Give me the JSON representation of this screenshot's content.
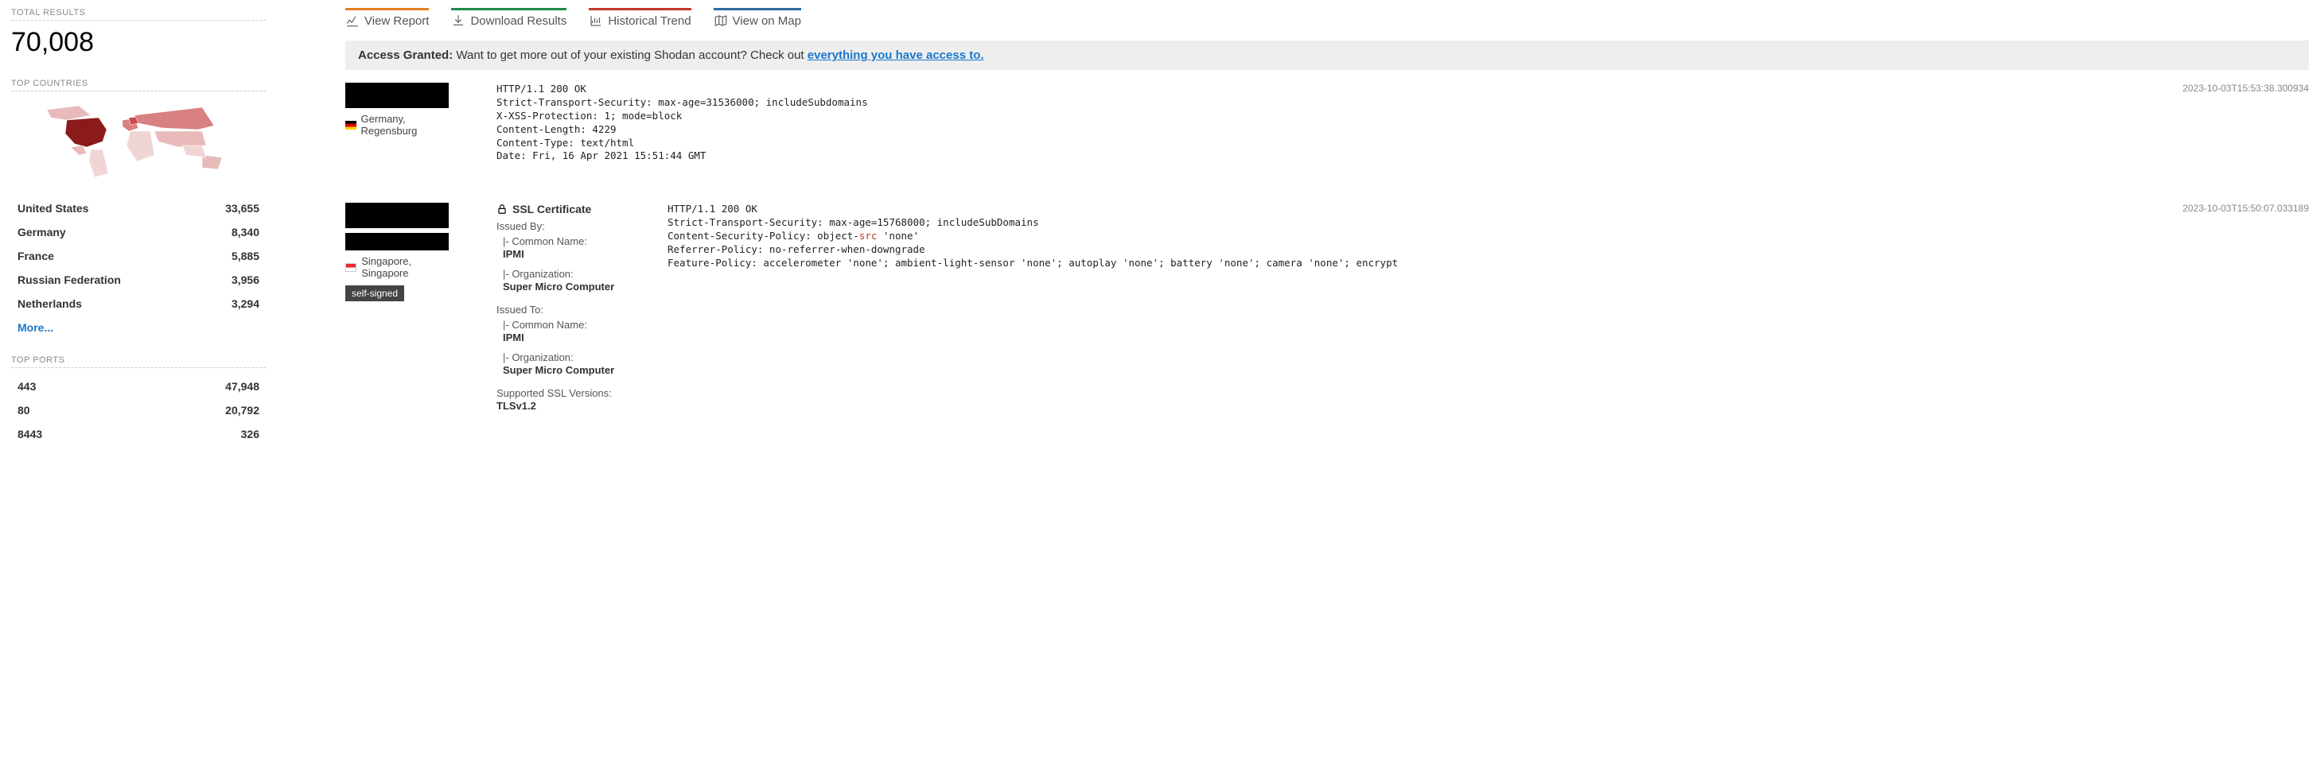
{
  "sidebar": {
    "total_results_label": "TOTAL RESULTS",
    "total_results_value": "70,008",
    "top_countries_label": "TOP COUNTRIES",
    "countries": [
      {
        "name": "United States",
        "count": "33,655"
      },
      {
        "name": "Germany",
        "count": "8,340"
      },
      {
        "name": "France",
        "count": "5,885"
      },
      {
        "name": "Russian Federation",
        "count": "3,956"
      },
      {
        "name": "Netherlands",
        "count": "3,294"
      }
    ],
    "more_label": "More...",
    "top_ports_label": "TOP PORTS",
    "ports": [
      {
        "name": "443",
        "count": "47,948"
      },
      {
        "name": "80",
        "count": "20,792"
      },
      {
        "name": "8443",
        "count": "326"
      }
    ]
  },
  "toolbar": {
    "view_report": "View Report",
    "download_results": "Download Results",
    "historical_trend": "Historical Trend",
    "view_on_map": "View on Map"
  },
  "notice": {
    "strong": "Access Granted:",
    "text": " Want to get more out of your existing Shodan account? Check out ",
    "link": "everything you have access to."
  },
  "results": [
    {
      "timestamp": "2023-10-03T15:53:38.300934",
      "country": "Germany",
      "city": "Regensburg",
      "http": "HTTP/1.1 200 OK\nStrict-Transport-Security: max-age=31536000; includeSubdomains\nX-XSS-Protection: 1; mode=block\nContent-Length: 4229\nContent-Type: text/html\nDate: Fri, 16 Apr 2021 15:51:44 GMT"
    },
    {
      "timestamp": "2023-10-03T15:50:07.033189",
      "country": "Singapore",
      "city": "Singapore",
      "tag": "self-signed",
      "ssl": {
        "title": "SSL Certificate",
        "issued_by_label": "Issued By:",
        "common_name_label": "|- Common Name:",
        "issued_by_cn": "IPMI",
        "organization_label": "|- Organization:",
        "issued_by_org": "Super Micro Computer",
        "issued_to_label": "Issued To:",
        "issued_to_cn": "IPMI",
        "issued_to_org": "Super Micro Computer",
        "supported_label": "Supported SSL Versions:",
        "supported_value": "TLSv1.2"
      },
      "http_pre": "HTTP/1.1 200 OK\nStrict-Transport-Security: max-age=15768000; includeSubDomains\nContent-Security-Policy: object-",
      "http_hl": "src",
      "http_post": " 'none'\nReferrer-Policy: no-referrer-when-downgrade\nFeature-Policy: accelerometer 'none'; ambient-light-sensor 'none'; autoplay 'none'; battery 'none'; camera 'none'; encrypt"
    }
  ]
}
